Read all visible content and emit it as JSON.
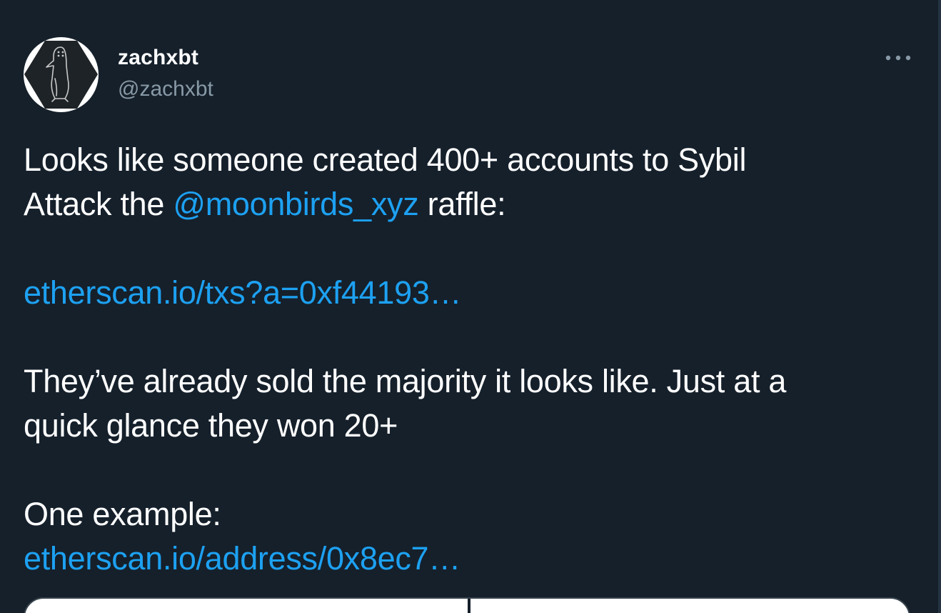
{
  "author": {
    "name": "zachxbt",
    "handle": "@zachxbt",
    "avatar_icon": "penguin-avatar-icon"
  },
  "menu": {
    "more_icon": "more-horizontal-icon"
  },
  "tweet": {
    "line1": "Looks like someone created 400+ accounts to Sybil",
    "line2_prefix": "Attack the ",
    "mention": "@moonbirds_xyz",
    "line2_suffix": " raffle:",
    "link1": "etherscan.io/txs?a=0xf44193…",
    "line3": "They’ve already sold the majority it looks like. Just at a",
    "line4": "quick glance they won 20+",
    "line5": "One example:",
    "link2": "etherscan.io/address/0x8ec7…"
  },
  "colors": {
    "background": "#15202b",
    "link": "#1da1f2",
    "secondary_text": "#8899a6"
  }
}
